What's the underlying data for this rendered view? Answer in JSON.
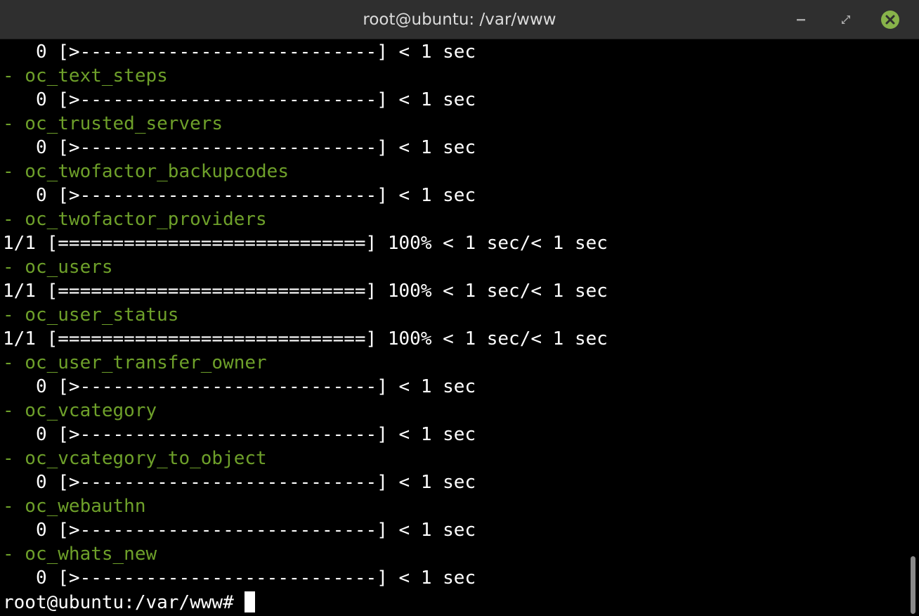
{
  "window": {
    "title": "root@ubuntu: /var/www",
    "buttons": {
      "minimize_icon": "minimize-icon",
      "maximize_icon": "maximize-icon",
      "close_icon": "close-icon",
      "close_color": "#88b34a"
    }
  },
  "terminal": {
    "text_color": "#ffffff",
    "table_color": "#6ea02a",
    "lines": [
      "   0 [>---------------------------] < 1 sec",
      "- oc_text_steps",
      "   0 [>---------------------------] < 1 sec",
      "- oc_trusted_servers",
      "   0 [>---------------------------] < 1 sec",
      "- oc_twofactor_backupcodes",
      "   0 [>---------------------------] < 1 sec",
      "- oc_twofactor_providers",
      "1/1 [============================] 100% < 1 sec/< 1 sec",
      "- oc_users",
      "1/1 [============================] 100% < 1 sec/< 1 sec",
      "- oc_user_status",
      "1/1 [============================] 100% < 1 sec/< 1 sec",
      "- oc_user_transfer_owner",
      "   0 [>---------------------------] < 1 sec",
      "- oc_vcategory",
      "   0 [>---------------------------] < 1 sec",
      "- oc_vcategory_to_object",
      "   0 [>---------------------------] < 1 sec",
      "- oc_webauthn",
      "   0 [>---------------------------] < 1 sec",
      "- oc_whats_new",
      "   0 [>---------------------------] < 1 sec"
    ],
    "prompt": "root@ubuntu:/var/www# "
  }
}
